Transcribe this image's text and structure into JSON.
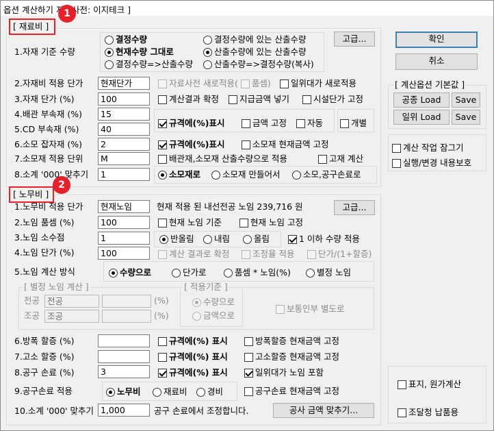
{
  "title": "옵션 계산하기 자료사전: 이지테크 ]",
  "sec1": {
    "header": "[ 재료비 ]",
    "badge": "1"
  },
  "sec2": {
    "header": "[ 노무비 ]",
    "badge": "2"
  },
  "r1": {
    "label": "1.자재 기준 수량",
    "o1": "결정수량",
    "o2": "현재수량 그대로",
    "o3": "결정수량=>산출수량",
    "o4": "결정수량에 있는 산출수량",
    "o5": "산출수량에 있는 산출수량",
    "o6": "산출수량=>결정수량(복사)",
    "adv": "고급..."
  },
  "r2": {
    "label": "2.자재비 적용 단가",
    "value": "현재단가",
    "cb1": "자료사전 새로적용(",
    "cb1b": "품셈",
    "cb1c": ")",
    "cb2": "일위대가 새로적용"
  },
  "r3": {
    "label": "3.자재 단가 (%)",
    "value": "100",
    "cb1": "계산결과 확정",
    "cb2": "지급금액 넣기",
    "cb3": "시설단가 고정"
  },
  "r4": {
    "label": "4.배관 부속재 (%)",
    "value": "15"
  },
  "r5": {
    "label": "5.CD  부속재 (%)",
    "value": "40",
    "cb1": "규격에(%)표시",
    "cb2": "금액 고정",
    "cb3": "자동",
    "cb4": "개별"
  },
  "r6": {
    "label": "6.소모 잡자재 (%)",
    "value": "2",
    "cb1": "규격에(%)표시",
    "cb2": "소모재 현재금액 고정"
  },
  "r7": {
    "label": "7.소모재 적용 단위",
    "value": "M",
    "cb1": "배관재,소모재 산출수량으로 적용",
    "cb2": "고재 계산"
  },
  "r8": {
    "label": "8.소계 '000' 맞추기",
    "value": "1",
    "o1": "소모재로",
    "o2": "소모재 만들어서",
    "o3": "소모,공구손료로"
  },
  "n1": {
    "label": "1.노무비 적용 단가",
    "value": "현재노임",
    "info": "현재 적용 된 내선전공 노임  239,716 원",
    "adv": "고급..."
  },
  "n2": {
    "label": "2.노임 품셈 (%)",
    "value": "100",
    "cb1": "현재 노임 기준",
    "cb2": "현재 노임 고정"
  },
  "n3": {
    "label": "3.노임 소수점",
    "value": "1",
    "o1": "반올림",
    "o2": "내림",
    "o3": "올림",
    "cb1": "1 이하 수량 적용"
  },
  "n4": {
    "label": "4.노임 단가 (%)",
    "value": "100",
    "cb1": "계산 결과로 확정",
    "cb2": "조정율 적용",
    "cb3": "단가/(1+할증)"
  },
  "n5": {
    "label": "5.노임 계산 방식",
    "o1": "수량으로",
    "o2": "단가로",
    "o3": "품셈 * 노임(%)",
    "o4": "별정 노임"
  },
  "sep": {
    "legend": "[ 별정 노임 계산 ]",
    "l1": "전공",
    "v1": "전공",
    "l2": "조공",
    "v2": "조공",
    "pct": "(%)",
    "legend2": "[ 적용기준 ]",
    "o1": "수량으로",
    "o2": "금액으로",
    "cb": "보통인부 별도로"
  },
  "n6": {
    "label": "6.방폭 할증 (%)",
    "cb1": "규격에(%) 표시",
    "cb2": "방폭할증 현재금액 고정"
  },
  "n7": {
    "label": "7.고소 할증 (%)",
    "cb1": "규격에(%) 표시",
    "cb2": "고소할증 현재금액 고정"
  },
  "n8": {
    "label": "8.공구 손료 (%)",
    "value": "3",
    "cb1": "규격에(%) 표시",
    "cb2": "일위대가 노임 포함"
  },
  "n9": {
    "label": "9.공구손료 적용",
    "o1": "노무비",
    "o2": "재료비",
    "o3": "경비",
    "cb": "공구손료 현재금액 고정"
  },
  "n10": {
    "label": "10.소계 '000' 맞추기",
    "value": "1,000",
    "info": "공구 손료에서 조정합니다.",
    "btn": "공사 금액 맞추기..."
  },
  "right": {
    "ok": "확인",
    "cancel": "취소",
    "legend": "[ 계산옵션 기본값 ]",
    "load1": "공종 Load",
    "save1": "Save",
    "load2": "일위 Load",
    "save2": "Save",
    "cb1": "계산 작업 잠그기",
    "cb2": "실행/변경 내용보호",
    "cb3": "표지, 원가계산",
    "cb4": "조달청  납품용"
  }
}
